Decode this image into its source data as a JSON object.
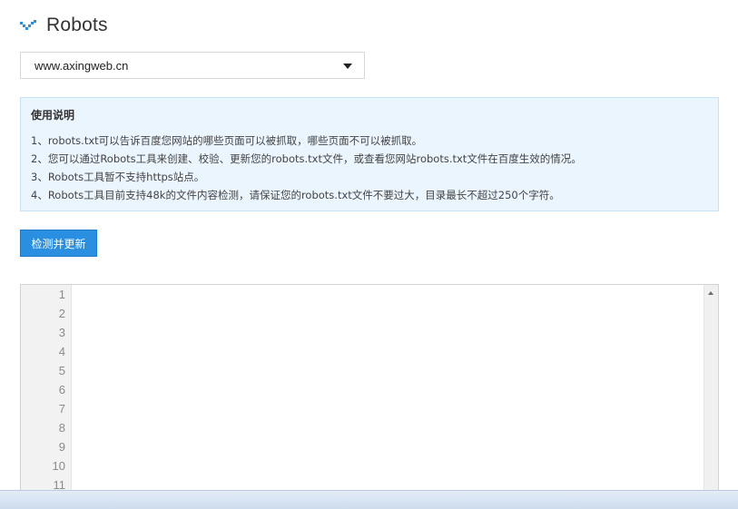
{
  "header": {
    "title": "Robots",
    "icon": "check-chevron-icon",
    "accent_color": "#2a8fe0"
  },
  "site_select": {
    "selected": "www.axingweb.cn"
  },
  "notice": {
    "title": "使用说明",
    "items": [
      "1、robots.txt可以告诉百度您网站的哪些页面可以被抓取，哪些页面不可以被抓取。",
      "2、您可以通过Robots工具来创建、校验、更新您的robots.txt文件，或查看您网站robots.txt文件在百度生效的情况。",
      "3、Robots工具暂不支持https站点。",
      "4、Robots工具目前支持48k的文件内容检测，请保证您的robots.txt文件不要过大，目录最长不超过250个字符。"
    ]
  },
  "actions": {
    "check_update_label": "检测并更新"
  },
  "editor": {
    "line_numbers": [
      "1",
      "2",
      "3",
      "4",
      "5",
      "6",
      "7",
      "8",
      "9",
      "10",
      "11"
    ],
    "content": ""
  }
}
